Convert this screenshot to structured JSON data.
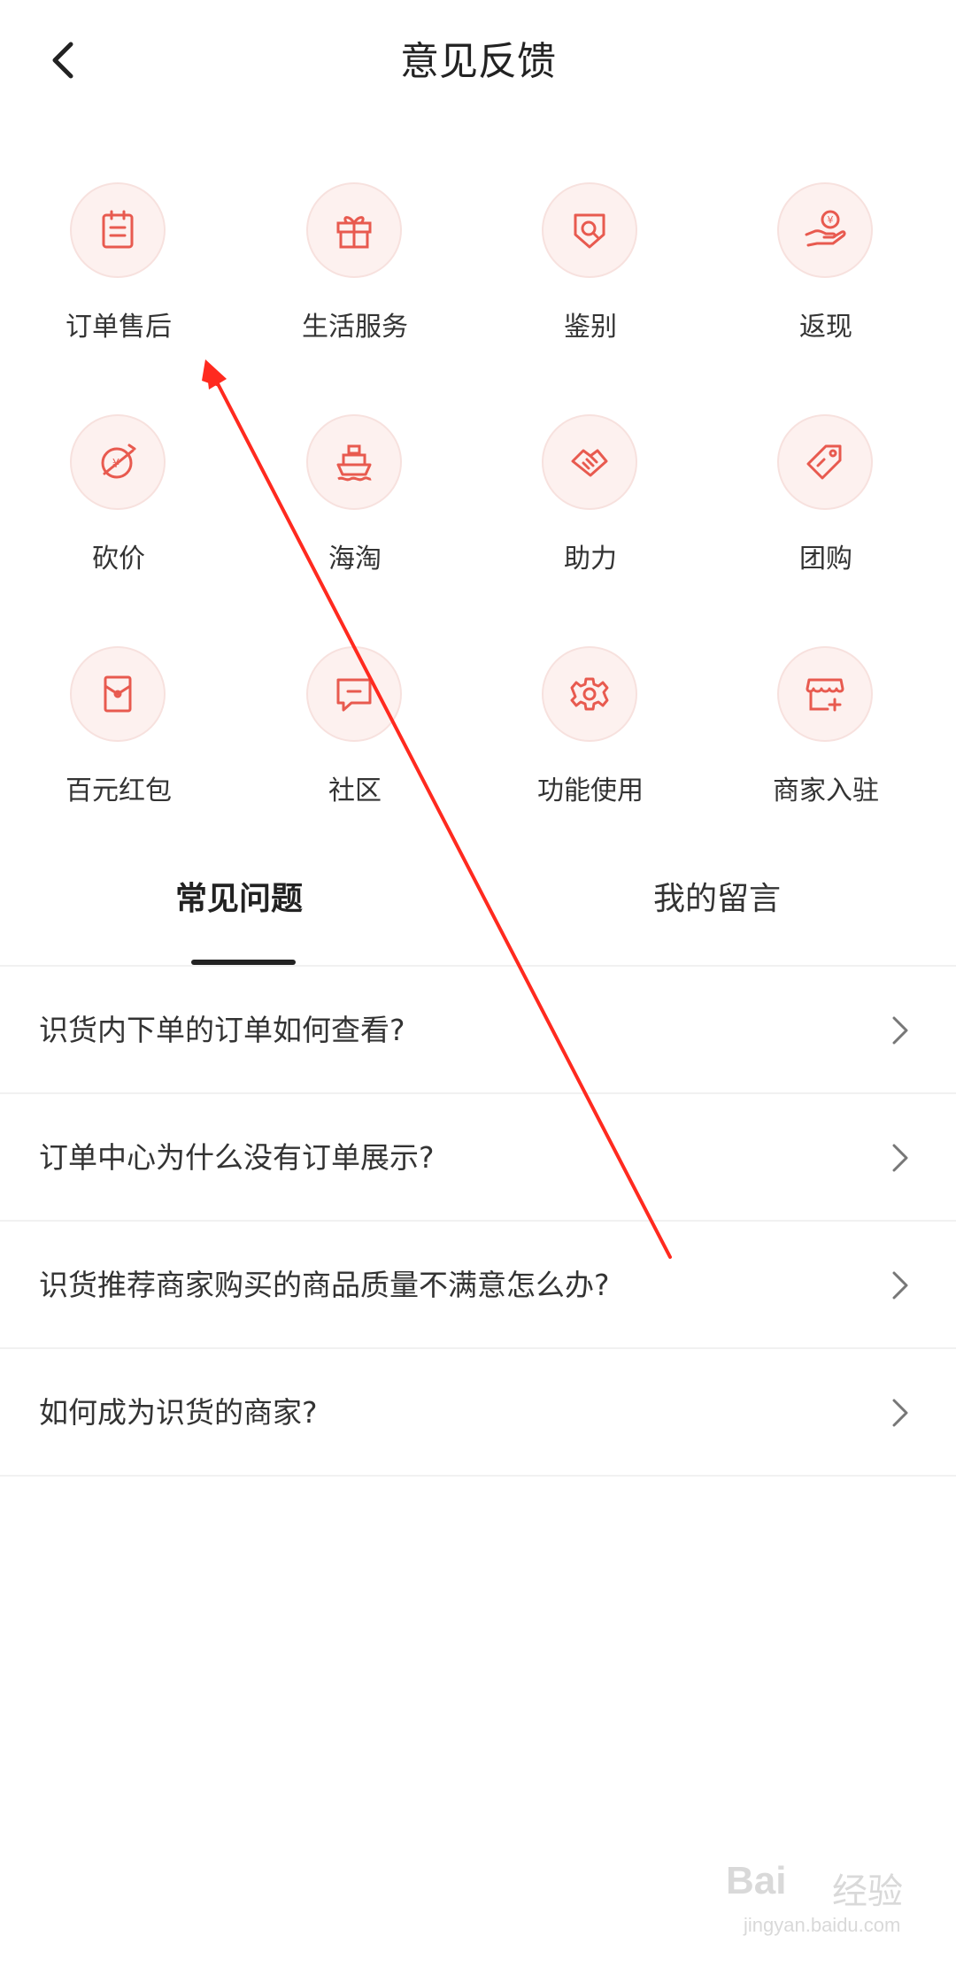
{
  "header": {
    "title": "意见反馈",
    "back_icon": "chevron-left-icon"
  },
  "categories": [
    {
      "label": "订单售后",
      "icon": "clipboard-icon"
    },
    {
      "label": "生活服务",
      "icon": "gift-icon"
    },
    {
      "label": "鉴别",
      "icon": "shield-search-icon"
    },
    {
      "label": "返现",
      "icon": "hand-coin-icon"
    },
    {
      "label": "砍价",
      "icon": "discount-cut-icon"
    },
    {
      "label": "海淘",
      "icon": "ship-icon"
    },
    {
      "label": "助力",
      "icon": "handshake-icon"
    },
    {
      "label": "团购",
      "icon": "tag-icon"
    },
    {
      "label": "百元红包",
      "icon": "red-envelope-icon"
    },
    {
      "label": "社区",
      "icon": "chat-bubble-icon"
    },
    {
      "label": "功能使用",
      "icon": "gear-icon"
    },
    {
      "label": "商家入驻",
      "icon": "store-icon"
    }
  ],
  "tabs": [
    {
      "label": "常见问题",
      "active": true
    },
    {
      "label": "我的留言",
      "active": false
    }
  ],
  "faq": [
    {
      "question": "识货内下单的订单如何查看?"
    },
    {
      "question": "订单中心为什么没有订单展示?"
    },
    {
      "question": "识货推荐商家购买的商品质量不满意怎么办?"
    },
    {
      "question": "如何成为识货的商家?"
    }
  ],
  "colors": {
    "accent": "#e85a4f",
    "icon_bg": "#fdf1ef",
    "annotation_arrow": "#ff2a1f"
  },
  "watermark": {
    "brand": "Bai",
    "brand_suffix": "经验",
    "url": "jingyan.baidu.com"
  }
}
